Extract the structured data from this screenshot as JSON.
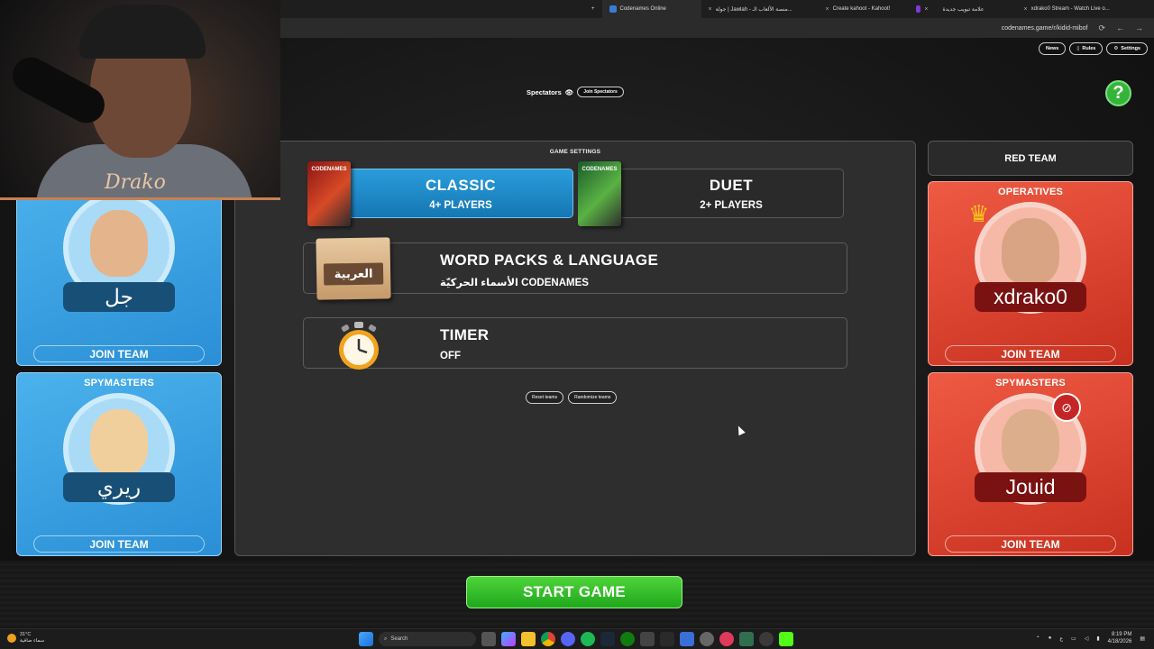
{
  "browser": {
    "tabs": [
      {
        "label": "Codenames Online",
        "active": true
      },
      {
        "label": "جولة | Jawlah - منصة الألعاب الـ...",
        "active": false
      },
      {
        "label": "Create kahoot - Kahoot!",
        "active": false
      },
      {
        "label": "",
        "active": false
      },
      {
        "label": "علامة تبويب جديدة",
        "active": false
      },
      {
        "label": "xdrako0 Stream - Watch Live o...",
        "active": false
      }
    ],
    "new_tab": "+",
    "url": "codenames.game/r/kidid-mibof"
  },
  "header": {
    "news": "News",
    "rules": "Rules",
    "settings": "Settings",
    "help": "?"
  },
  "spectators": {
    "label": "Spectators",
    "join": "Join Spectators"
  },
  "settings_panel": {
    "title": "GAME SETTINGS",
    "modes": [
      {
        "name": "CLASSIC",
        "players": "4+ PLAYERS",
        "box": "CODENAMES",
        "selected": true
      },
      {
        "name": "DUET",
        "players": "2+ PLAYERS",
        "box": "CODENAMES",
        "selected": false
      }
    ],
    "word_packs": {
      "title": "WORD PACKS & LANGUAGE",
      "value": "الأسماء الحركيّة CODENAMES",
      "badge": "العربية"
    },
    "timer": {
      "title": "TIMER",
      "value": "OFF"
    },
    "reset": "Reset teams",
    "randomize": "Randomize teams"
  },
  "blue_team": {
    "operatives": {
      "title": "",
      "player": "جل",
      "join": "JOIN TEAM"
    },
    "spymasters": {
      "title": "SPYMASTERS",
      "player": "ريري",
      "join": "JOIN TEAM"
    }
  },
  "red_team": {
    "title": "RED TEAM",
    "operatives": {
      "title": "OPERATIVES",
      "player": "xdrako0",
      "join": "JOIN TEAM"
    },
    "spymasters": {
      "title": "SPYMASTERS",
      "player": "Jouid",
      "join": "JOIN TEAM"
    }
  },
  "start_button": "START GAME",
  "webcam": {
    "signature": "Drako"
  },
  "taskbar": {
    "weather_temp": "31°C",
    "weather_desc": "سماء صافية",
    "search": "Search",
    "time": "8:19 PM",
    "date": "4/18/2026",
    "lang": "ع"
  },
  "colors": {
    "blue_team": "#2a8fd6",
    "red_team": "#c8301f",
    "start_green": "#1fa71c",
    "help_green": "#35b43a"
  }
}
